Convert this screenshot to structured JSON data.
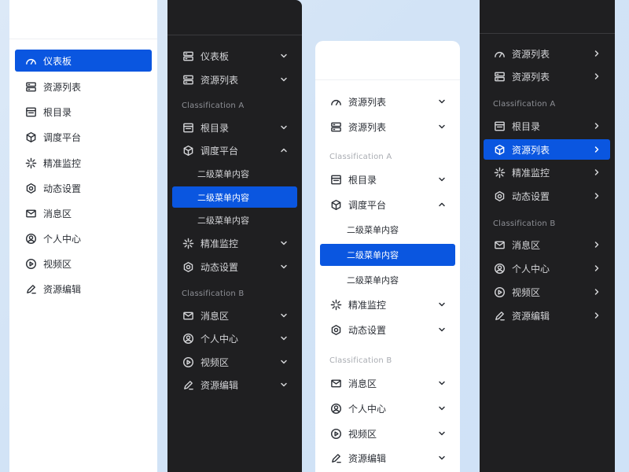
{
  "accent_color": "#0a56e0",
  "panels": {
    "p1": {
      "items": [
        {
          "label": "仪表板",
          "icon": "gauge-icon"
        },
        {
          "label": "资源列表",
          "icon": "server-icon"
        },
        {
          "label": "根目录",
          "icon": "window-icon"
        },
        {
          "label": "调度平台",
          "icon": "cube-icon"
        },
        {
          "label": "精准监控",
          "icon": "sparkle-icon"
        },
        {
          "label": "动态设置",
          "icon": "hexagon-gear-icon"
        },
        {
          "label": "消息区",
          "icon": "mail-icon"
        },
        {
          "label": "个人中心",
          "icon": "user-circle-icon"
        },
        {
          "label": "视频区",
          "icon": "play-circle-icon"
        },
        {
          "label": "资源编辑",
          "icon": "pen-icon"
        }
      ]
    },
    "p2": {
      "top_items": [
        {
          "label": "仪表板",
          "icon": "server-icon"
        },
        {
          "label": "资源列表",
          "icon": "server-icon"
        }
      ],
      "section_a": "Classification A",
      "a_items": [
        {
          "label": "根目录",
          "icon": "window-icon"
        },
        {
          "label": "调度平台",
          "icon": "cube-icon"
        }
      ],
      "sub_items": [
        "二级菜单内容",
        "二级菜单内容",
        "二级菜单内容"
      ],
      "a_items2": [
        {
          "label": "精准监控",
          "icon": "sparkle-icon"
        },
        {
          "label": "动态设置",
          "icon": "hexagon-gear-icon"
        }
      ],
      "section_b": "Classification B",
      "b_items": [
        {
          "label": "消息区",
          "icon": "mail-icon"
        },
        {
          "label": "个人中心",
          "icon": "user-circle-icon"
        },
        {
          "label": "视频区",
          "icon": "play-circle-icon"
        },
        {
          "label": "资源编辑",
          "icon": "pen-icon"
        }
      ]
    },
    "p3": {
      "top_items": [
        {
          "label": "资源列表",
          "icon": "gauge-icon"
        },
        {
          "label": "资源列表",
          "icon": "server-icon"
        }
      ],
      "section_a": "Classification A",
      "a_items": [
        {
          "label": "根目录",
          "icon": "window-icon"
        },
        {
          "label": "调度平台",
          "icon": "cube-icon"
        }
      ],
      "sub_items": [
        "二级菜单内容",
        "二级菜单内容",
        "二级菜单内容"
      ],
      "a_items2": [
        {
          "label": "精准监控",
          "icon": "sparkle-icon"
        },
        {
          "label": "动态设置",
          "icon": "hexagon-gear-icon"
        }
      ],
      "section_b": "Classification B",
      "b_items": [
        {
          "label": "消息区",
          "icon": "mail-icon"
        },
        {
          "label": "个人中心",
          "icon": "user-circle-icon"
        },
        {
          "label": "视频区",
          "icon": "play-circle-icon"
        },
        {
          "label": "资源编辑",
          "icon": "pen-icon"
        }
      ]
    },
    "p4": {
      "top_items": [
        {
          "label": "资源列表",
          "icon": "gauge-icon"
        },
        {
          "label": "资源列表",
          "icon": "server-icon"
        }
      ],
      "section_a": "Classification A",
      "a_items": [
        {
          "label": "根目录",
          "icon": "window-icon"
        },
        {
          "label": "资源列表",
          "icon": "cube-icon"
        },
        {
          "label": "精准监控",
          "icon": "sparkle-icon"
        },
        {
          "label": "动态设置",
          "icon": "hexagon-gear-icon"
        }
      ],
      "section_b": "Classification B",
      "b_items": [
        {
          "label": "消息区",
          "icon": "mail-icon"
        },
        {
          "label": "个人中心",
          "icon": "user-circle-icon"
        },
        {
          "label": "视频区",
          "icon": "play-circle-icon"
        },
        {
          "label": "资源编辑",
          "icon": "pen-icon"
        }
      ]
    }
  }
}
